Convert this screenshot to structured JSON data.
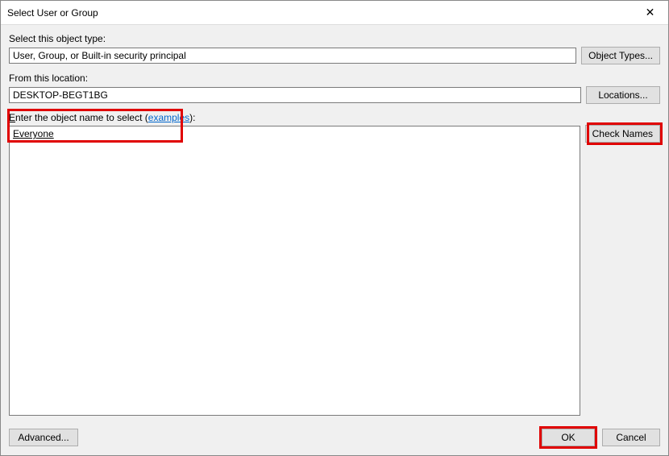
{
  "titlebar": {
    "title": "Select User or Group",
    "close_label": "✕"
  },
  "object_type": {
    "label": "Select this object type:",
    "value": "User, Group, or Built-in security principal",
    "button": "Object Types..."
  },
  "location": {
    "label": "From this location:",
    "value": "DESKTOP-BEGT1BG",
    "button": "Locations..."
  },
  "enter": {
    "label_prefix_underlined": "E",
    "label_rest": "nter the object name to select ",
    "examples_link": "examples",
    "label_suffix": ":",
    "value": "Everyone",
    "button": "Check Names"
  },
  "footer": {
    "advanced": "Advanced...",
    "ok": "OK",
    "cancel": "Cancel"
  }
}
